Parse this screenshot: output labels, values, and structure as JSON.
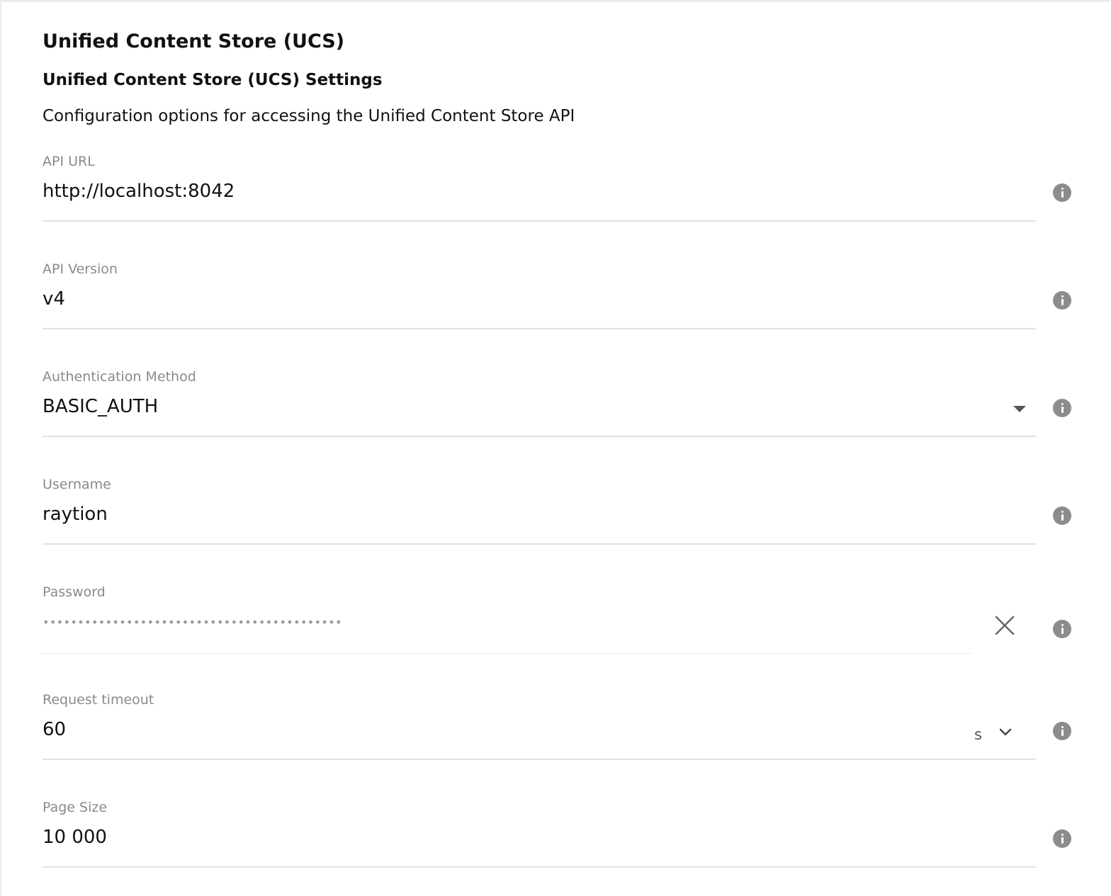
{
  "page": {
    "title": "Unified Content Store (UCS)",
    "section_title": "Unified Content Store (UCS) Settings",
    "section_description": "Configuration options for accessing the Unified Content Store API"
  },
  "fields": {
    "api_url": {
      "label": "API URL",
      "value": "http://localhost:8042",
      "info_icon": "info-icon"
    },
    "api_version": {
      "label": "API Version",
      "value": "v4",
      "info_icon": "info-icon"
    },
    "auth_method": {
      "label": "Authentication Method",
      "value": "BASIC_AUTH",
      "control_icon": "dropdown-arrow-icon",
      "info_icon": "info-icon"
    },
    "username": {
      "label": "Username",
      "value": "raytion",
      "info_icon": "info-icon"
    },
    "password": {
      "label": "Password",
      "masked_value": "•••••••••••••••••••••••••••••••••••••••••••",
      "clear_icon": "close-icon",
      "info_icon": "info-icon"
    },
    "request_timeout": {
      "label": "Request timeout",
      "value": "60",
      "unit": "s",
      "unit_icon": "chevron-down-icon",
      "info_icon": "info-icon"
    },
    "page_size": {
      "label": "Page Size",
      "value": "10 000",
      "info_icon": "info-icon"
    }
  },
  "colors": {
    "label": "#8a8a8a",
    "value": "#111111",
    "divider": "#e2e2e2",
    "info_icon": "#8c8c8c"
  }
}
